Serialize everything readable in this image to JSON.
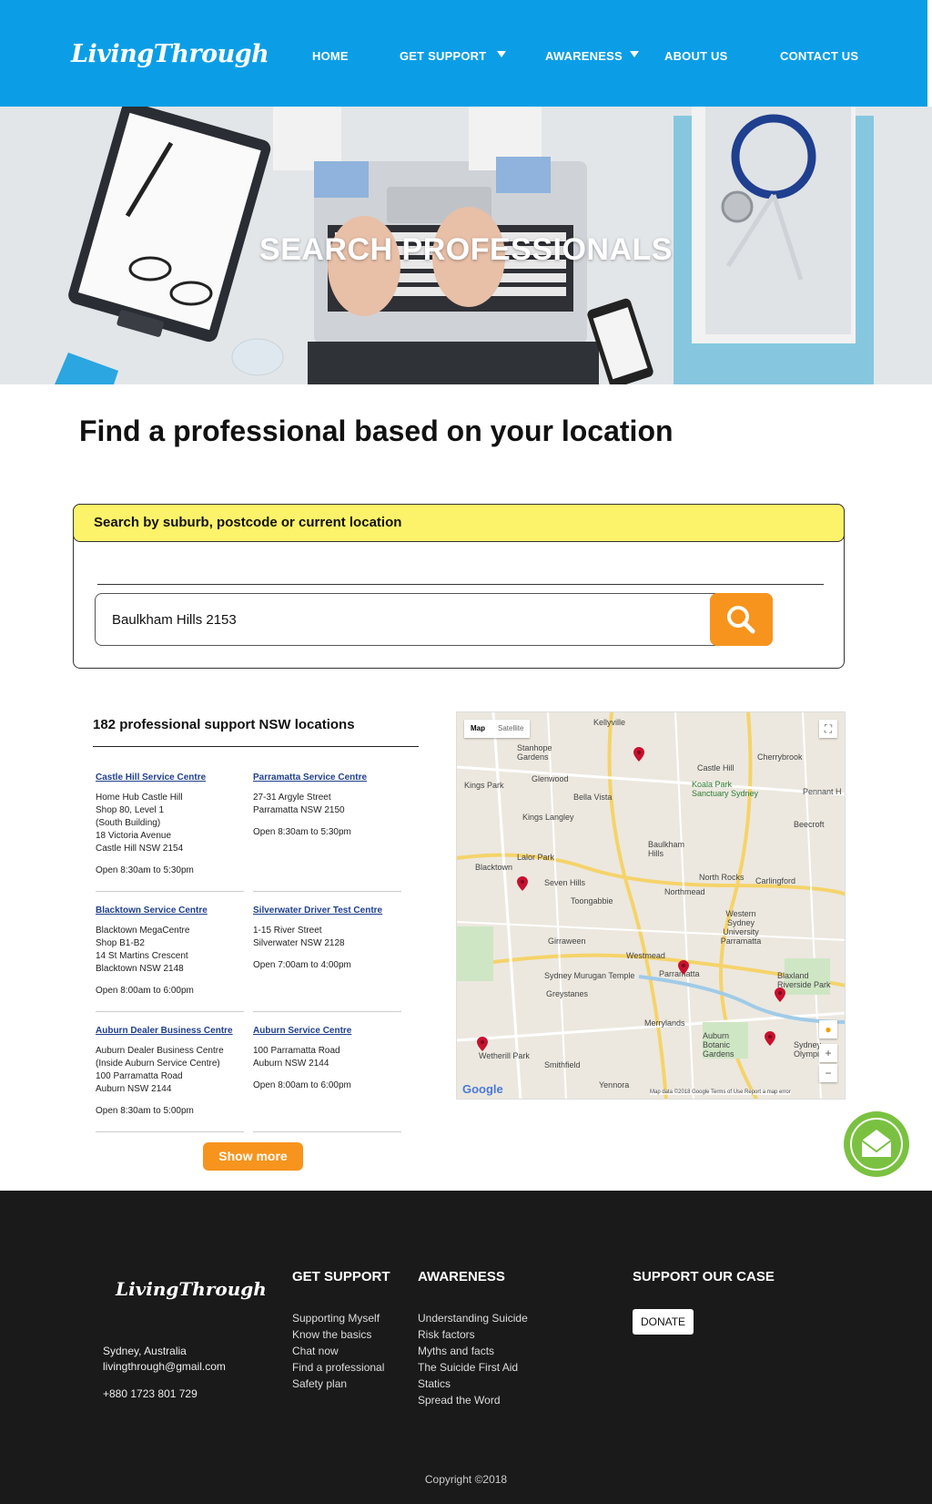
{
  "brand": {
    "logo_text": "LivingThrough"
  },
  "nav": {
    "home": "HOME",
    "get_support": "GET SUPPORT",
    "awareness": "AWARENESS",
    "about_us": "ABOUT US",
    "contact_us": "CONTACT US"
  },
  "hero": {
    "title": "SEARCH PROFESSIONALS"
  },
  "main": {
    "heading": "Find a professional based on your location",
    "search": {
      "label": "Search by suburb, postcode or current location",
      "value": "Baulkham Hills 2153"
    },
    "results": {
      "title": "182 professional support NSW locations",
      "show_more": "Show more",
      "locations": [
        {
          "name": "Castle Hill Service Centre",
          "lines": [
            "Home Hub Castle Hill",
            "Shop 80, Level 1",
            "(South Building)",
            "18 Victoria Avenue",
            "Castle Hill NSW 2154"
          ],
          "hours": "Open 8:30am to 5:30pm"
        },
        {
          "name": "Parramatta Service Centre",
          "lines": [
            "27-31 Argyle Street",
            "Parramatta NSW 2150"
          ],
          "hours": "Open 8:30am to 5:30pm"
        },
        {
          "name": "Blacktown Service Centre",
          "lines": [
            "Blacktown MegaCentre",
            "Shop B1-B2",
            "14 St Martins Crescent",
            "Blacktown NSW 2148"
          ],
          "hours": "Open 8:00am to 6:00pm"
        },
        {
          "name": "Silverwater Driver Test Centre",
          "lines": [
            "1-15 River Street",
            "Silverwater NSW 2128"
          ],
          "hours": "Open 7:00am to 4:00pm"
        },
        {
          "name": "Auburn Dealer Business Centre",
          "lines": [
            "Auburn Dealer Business Centre",
            "(Inside Auburn Service Centre)",
            "100 Parramatta Road",
            "Auburn NSW 2144"
          ],
          "hours": "Open 8:30am to 5:00pm"
        },
        {
          "name": "Auburn Service Centre",
          "lines": [
            "100 Parramatta Road",
            "Auburn NSW 2144"
          ],
          "hours": "Open 8:00am to 6:00pm"
        }
      ]
    },
    "map": {
      "toggle_map": "Map",
      "toggle_satellite": "Satellite",
      "google": "Google",
      "attribution": "Map data ©2018 Google   Terms of Use   Report a map error",
      "places": [
        "Kellyville",
        "Stanhope Gardens",
        "Castle Hill",
        "Cherrybrook",
        "Kings Park",
        "Glenwood",
        "Bella Vista",
        "Koala Park Sanctuary Sydney",
        "Pennant H",
        "Kings Langley",
        "Beecroft",
        "Baulkham Hills",
        "Lalor Park",
        "Blacktown",
        "Seven Hills",
        "North Rocks",
        "Carlingford",
        "Toongabbie",
        "Northmead",
        "Western Sydney University Parramatta",
        "Girraween",
        "Westmead",
        "Sydney Murugan Temple",
        "Parramatta",
        "Greystanes",
        "Blaxland Riverside Park",
        "Merrylands",
        "Auburn Botanic Gardens",
        "Wetherill Park",
        "Smithfield",
        "Yennora",
        "Sydney Olympic"
      ],
      "zoom_in": "+",
      "zoom_out": "−"
    }
  },
  "footer": {
    "logo_text": "LivingThrough",
    "city": "Sydney, Australia",
    "email": "livingthrough@gmail.com",
    "phone": "+880 1723 801 729",
    "get_support": {
      "heading": "GET SUPPORT",
      "links": [
        "Supporting Myself",
        "Know the basics",
        "Chat now",
        "Find a professional",
        "Safety plan"
      ]
    },
    "awareness": {
      "heading": "AWARENESS",
      "links": [
        "Understanding Suicide",
        "Risk factors",
        "Myths and facts",
        "The Suicide First Aid",
        "Statics",
        "Spread the Word"
      ]
    },
    "support_case": {
      "heading": "SUPPORT OUR CASE",
      "donate": "DONATE"
    },
    "copyright": "Copyright ©2018"
  },
  "colors": {
    "header_blue": "#0b9ee6",
    "accent_orange": "#f7941d",
    "label_yellow": "#fdf36a",
    "fab_green": "#7ac141",
    "footer_dark": "#1a1a1a"
  }
}
